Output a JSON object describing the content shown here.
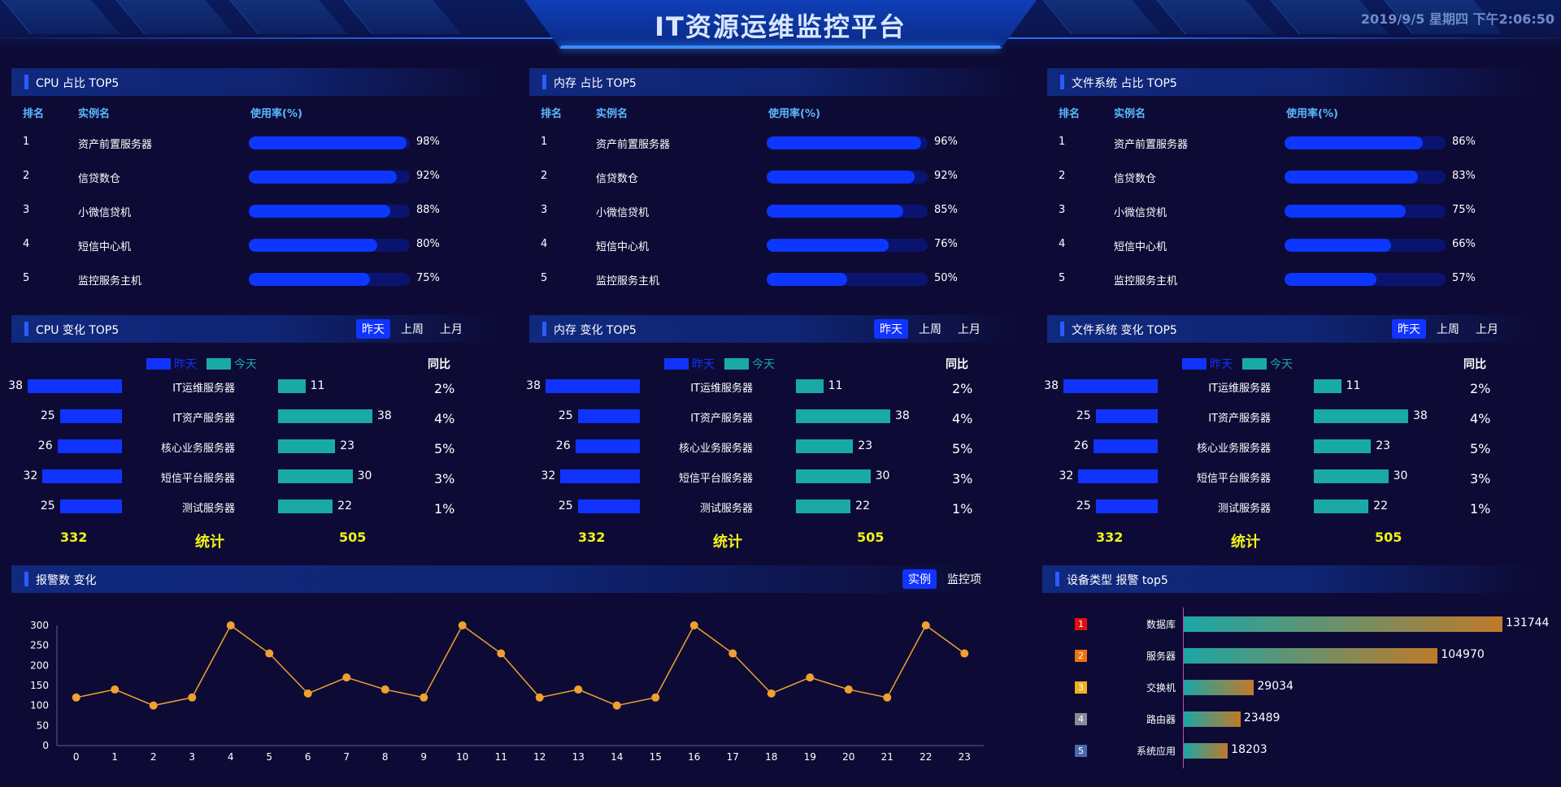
{
  "header": {
    "title": "IT资源运维监控平台",
    "datetime": "2019/9/5 星期四 下午2:06:50"
  },
  "usage_panels": [
    {
      "title": "CPU 占比 TOP5",
      "columns": [
        "排名",
        "实例名",
        "使用率(%)"
      ],
      "rows": [
        {
          "rank": "1",
          "name": "资产前置服务器",
          "pct": "98%",
          "value": 98
        },
        {
          "rank": "2",
          "name": "信贷数仓",
          "pct": "92%",
          "value": 92
        },
        {
          "rank": "3",
          "name": "小微信贷机",
          "pct": "88%",
          "value": 88
        },
        {
          "rank": "4",
          "name": "短信中心机",
          "pct": "80%",
          "value": 80
        },
        {
          "rank": "5",
          "name": "监控服务主机",
          "pct": "75%",
          "value": 75
        }
      ]
    },
    {
      "title": "内存 占比 TOP5",
      "columns": [
        "排名",
        "实例名",
        "使用率(%)"
      ],
      "rows": [
        {
          "rank": "1",
          "name": "资产前置服务器",
          "pct": "96%",
          "value": 96
        },
        {
          "rank": "2",
          "name": "信贷数仓",
          "pct": "92%",
          "value": 92
        },
        {
          "rank": "3",
          "name": "小微信贷机",
          "pct": "85%",
          "value": 85
        },
        {
          "rank": "4",
          "name": "短信中心机",
          "pct": "76%",
          "value": 76
        },
        {
          "rank": "5",
          "name": "监控服务主机",
          "pct": "50%",
          "value": 50
        }
      ]
    },
    {
      "title": "文件系统 占比 TOP5",
      "columns": [
        "排名",
        "实例名",
        "使用率(%)"
      ],
      "rows": [
        {
          "rank": "1",
          "name": "资产前置服务器",
          "pct": "86%",
          "value": 86
        },
        {
          "rank": "2",
          "name": "信贷数仓",
          "pct": "83%",
          "value": 83
        },
        {
          "rank": "3",
          "name": "小微信贷机",
          "pct": "75%",
          "value": 75
        },
        {
          "rank": "4",
          "name": "短信中心机",
          "pct": "66%",
          "value": 66
        },
        {
          "rank": "5",
          "name": "监控服务主机",
          "pct": "57%",
          "value": 57
        }
      ]
    }
  ],
  "change_panels": [
    {
      "title": "CPU 变化 TOP5",
      "tabs": [
        "昨天",
        "上周",
        "上月"
      ],
      "legend": [
        "昨天",
        "今天"
      ],
      "yoy_label": "同比",
      "rows": [
        {
          "server": "IT运维服务器",
          "yesterday": 38,
          "today": 11,
          "yoy": "2%"
        },
        {
          "server": "IT资产服务器",
          "yesterday": 25,
          "today": 38,
          "yoy": "4%"
        },
        {
          "server": "核心业务服务器",
          "yesterday": 26,
          "today": 23,
          "yoy": "5%"
        },
        {
          "server": "短信平台服务器",
          "yesterday": 32,
          "today": 30,
          "yoy": "3%"
        },
        {
          "server": "测试服务器",
          "yesterday": 25,
          "today": 22,
          "yoy": "1%"
        }
      ],
      "totals": {
        "yesterday": "332",
        "label": "统计",
        "today": "505"
      }
    },
    {
      "title": "内存 变化 TOP5",
      "tabs": [
        "昨天",
        "上周",
        "上月"
      ],
      "legend": [
        "昨天",
        "今天"
      ],
      "yoy_label": "同比",
      "rows": [
        {
          "server": "IT运维服务器",
          "yesterday": 38,
          "today": 11,
          "yoy": "2%"
        },
        {
          "server": "IT资产服务器",
          "yesterday": 25,
          "today": 38,
          "yoy": "4%"
        },
        {
          "server": "核心业务服务器",
          "yesterday": 26,
          "today": 23,
          "yoy": "5%"
        },
        {
          "server": "短信平台服务器",
          "yesterday": 32,
          "today": 30,
          "yoy": "3%"
        },
        {
          "server": "测试服务器",
          "yesterday": 25,
          "today": 22,
          "yoy": "1%"
        }
      ],
      "totals": {
        "yesterday": "332",
        "label": "统计",
        "today": "505"
      }
    },
    {
      "title": "文件系统 变化 TOP5",
      "tabs": [
        "昨天",
        "上周",
        "上月"
      ],
      "legend": [
        "昨天",
        "今天"
      ],
      "yoy_label": "同比",
      "rows": [
        {
          "server": "IT运维服务器",
          "yesterday": 38,
          "today": 11,
          "yoy": "2%"
        },
        {
          "server": "IT资产服务器",
          "yesterday": 25,
          "today": 38,
          "yoy": "4%"
        },
        {
          "server": "核心业务服务器",
          "yesterday": 26,
          "today": 23,
          "yoy": "5%"
        },
        {
          "server": "短信平台服务器",
          "yesterday": 32,
          "today": 30,
          "yoy": "3%"
        },
        {
          "server": "测试服务器",
          "yesterday": 25,
          "today": 22,
          "yoy": "1%"
        }
      ],
      "totals": {
        "yesterday": "332",
        "label": "统计",
        "today": "505"
      }
    }
  ],
  "alarm_panel": {
    "title": "报警数 变化",
    "tabs": [
      "实例",
      "监控项"
    ]
  },
  "device_panel": {
    "title": "设备类型 报警 top5",
    "rows": [
      {
        "rank": "1",
        "label": "数据库",
        "value": 131744,
        "badge_color": "#e01010"
      },
      {
        "rank": "2",
        "label": "服务器",
        "value": 104970,
        "badge_color": "#f07010"
      },
      {
        "rank": "3",
        "label": "交换机",
        "value": 29034,
        "badge_color": "#f0b020"
      },
      {
        "rank": "4",
        "label": "路由器",
        "value": 23489,
        "badge_color": "#8a8a9a"
      },
      {
        "rank": "5",
        "label": "系统应用",
        "value": 18203,
        "badge_color": "#4a6ab0"
      }
    ]
  },
  "colors": {
    "accent_blue": "#1133ff",
    "accent_teal": "#19aaa8",
    "line_orange": "#f0a030",
    "total_yellow": "#f2f21a"
  },
  "chart_data": {
    "type": "line",
    "x": [
      0,
      1,
      2,
      3,
      4,
      5,
      6,
      7,
      8,
      9,
      10,
      11,
      12,
      13,
      14,
      15,
      16,
      17,
      18,
      19,
      20,
      21,
      22,
      23
    ],
    "series": [
      {
        "values": [
          120,
          140,
          100,
          120,
          300,
          230,
          130,
          170,
          140,
          120,
          300,
          230,
          120,
          140,
          100,
          120,
          300,
          230,
          130,
          170,
          140,
          120,
          300,
          230
        ]
      }
    ],
    "yticks": [
      0,
      50,
      100,
      150,
      200,
      250,
      300
    ],
    "ylim": [
      0,
      300
    ],
    "grid": false
  }
}
